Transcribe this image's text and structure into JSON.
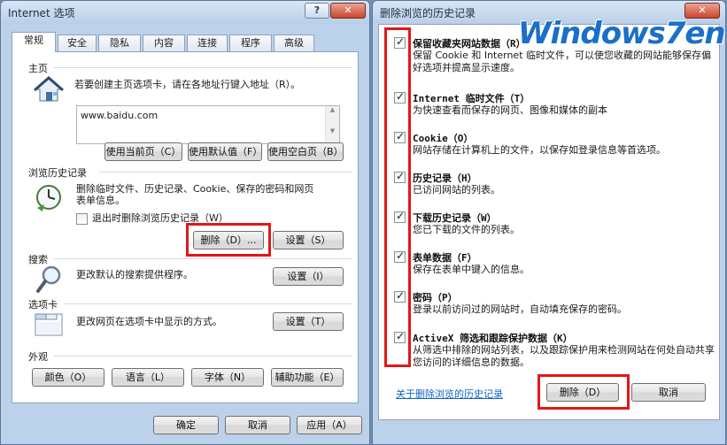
{
  "internet_options": {
    "title": "Internet 选项",
    "help_btn": "?",
    "close_btn": "✕",
    "tabs": [
      "常规",
      "安全",
      "隐私",
      "内容",
      "连接",
      "程序",
      "高级"
    ],
    "home": {
      "label": "主页",
      "desc": "若要创建主页选项卡，请在各地址行键入地址（R）。",
      "url": "www.baidu.com",
      "buttons": [
        "使用当前页（C）",
        "使用默认值（F）",
        "使用空白页（B）"
      ]
    },
    "history": {
      "label": "浏览历史记录",
      "desc1": "删除临时文件、历史记录、Cookie、保存的密码和网页",
      "desc2": "表单信息。",
      "checkbox": "退出时删除浏览历史记录（W）",
      "delete_btn": "删除（D）...",
      "settings_btn": "设置（S）"
    },
    "search": {
      "label": "搜索",
      "desc": "更改默认的搜索提供程序。",
      "settings_btn": "设置（I）"
    },
    "tabs_section": {
      "label": "选项卡",
      "desc": "更改网页在选项卡中显示的方式。",
      "settings_btn": "设置（T）"
    },
    "appearance": {
      "label": "外观",
      "buttons": [
        "颜色（O）",
        "语言（L）",
        "字体（N）",
        "辅助功能（E）"
      ]
    },
    "footer": {
      "ok": "确定",
      "cancel": "取消",
      "apply": "应用（A）"
    }
  },
  "delete_history": {
    "title": "删除浏览的历史记录",
    "close_btn": "✕",
    "items": [
      {
        "title": "保留收藏夹网站数据（R）",
        "desc": "保留 Cookie 和 Internet 临时文件，可以使您收藏的网站能够保存偏好选项并提高显示速度。",
        "checked": true
      },
      {
        "title": "Internet 临时文件（T）",
        "desc": "为快速查看而保存的网页、图像和媒体的副本",
        "checked": true
      },
      {
        "title": "Cookie（O）",
        "desc": "网站存储在计算机上的文件，以保存如登录信息等首选项。",
        "checked": true
      },
      {
        "title": "历史记录（H）",
        "desc": "已访问网站的列表。",
        "checked": true
      },
      {
        "title": "下载历史记录（W）",
        "desc": "您已下载的文件的列表。",
        "checked": true
      },
      {
        "title": "表单数据（F）",
        "desc": "保存在表单中键入的信息。",
        "checked": true
      },
      {
        "title": "密码（P）",
        "desc": "登录以前访问过的网站时，自动填充保存的密码。",
        "checked": true
      },
      {
        "title": "ActiveX 筛选和跟踪保护数据（K）",
        "desc": "从筛选中排除的网站列表，以及跟踪保护用来检测网站在何处自动共享您访问的详细信息的数据。",
        "checked": true
      }
    ],
    "about_link": "关于删除浏览的历史记录",
    "delete_btn": "删除（D）",
    "cancel_btn": "取消"
  },
  "watermark": "Windows7en"
}
